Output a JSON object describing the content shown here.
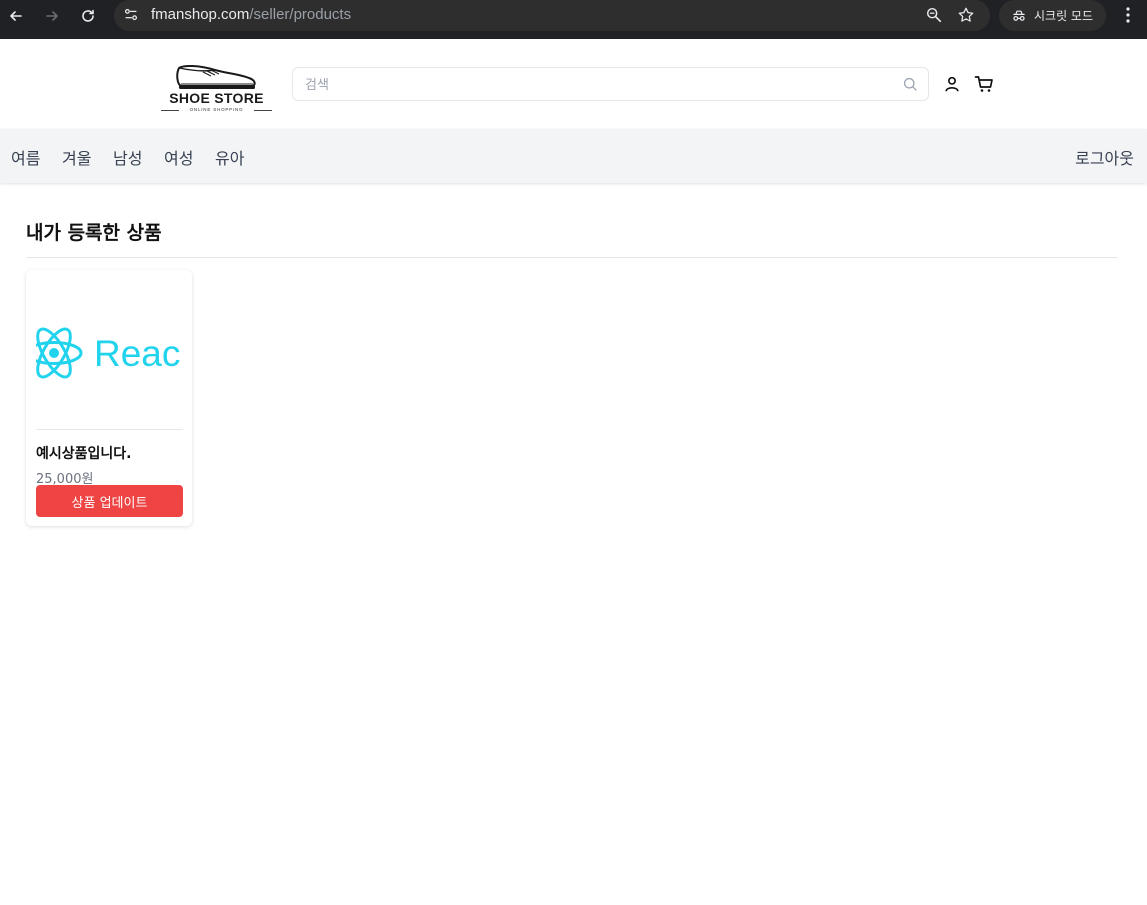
{
  "browser": {
    "url_host": "fmanshop.com",
    "url_path": "/seller/products",
    "incognito_label": "시크릿 모드"
  },
  "header": {
    "logo_title": "SHOE STORE",
    "logo_subtitle": "ONLINE SHOPPING",
    "search_placeholder": "검색",
    "search_value": ""
  },
  "categories": [
    {
      "label": "여름"
    },
    {
      "label": "겨울"
    },
    {
      "label": "남성"
    },
    {
      "label": "여성"
    },
    {
      "label": "유아"
    }
  ],
  "logout_label": "로그아웃",
  "main": {
    "title": "내가 등록한 상품",
    "products": [
      {
        "image_text": "Reac",
        "name": "예시상품입니다.",
        "price": "25,000원",
        "button_label": "상품 업데이트"
      }
    ]
  },
  "colors": {
    "chrome_bg": "#202124",
    "button_red": "#ef4444",
    "react_cyan": "#22d3ee",
    "category_bar": "#f3f4f6"
  }
}
